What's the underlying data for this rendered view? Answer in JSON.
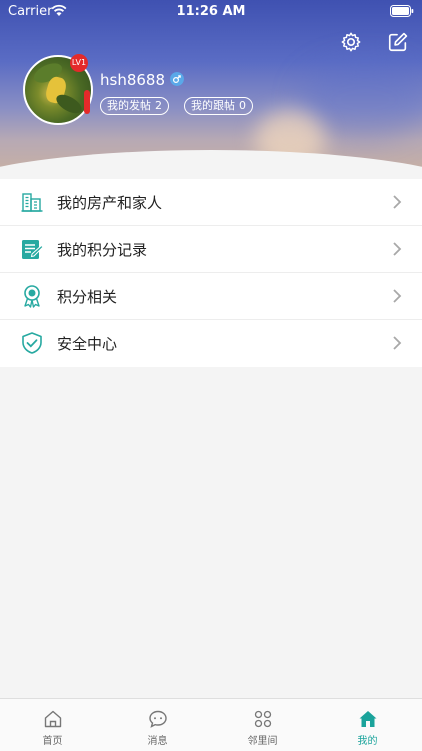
{
  "status_bar": {
    "carrier": "Carrier",
    "time": "11:26 AM"
  },
  "header": {
    "settings_icon": "gear-icon",
    "edit_icon": "edit-icon",
    "level_badge": "LV1",
    "username": "hsh8688",
    "gender_icon": "male-icon",
    "posts_label": "我的发帖",
    "posts_count": "2",
    "replies_label": "我的跟帖",
    "replies_count": "0"
  },
  "menu": {
    "items": [
      {
        "label": "我的房产和家人",
        "icon": "building-icon"
      },
      {
        "label": "我的积分记录",
        "icon": "points-record-icon"
      },
      {
        "label": "积分相关",
        "icon": "medal-icon"
      },
      {
        "label": "安全中心",
        "icon": "shield-check-icon"
      }
    ]
  },
  "tabbar": {
    "tabs": [
      {
        "label": "首页",
        "icon": "home-outline-icon"
      },
      {
        "label": "消息",
        "icon": "chat-icon"
      },
      {
        "label": "邻里间",
        "icon": "grid-icon"
      },
      {
        "label": "我的",
        "icon": "home-filled-icon",
        "active": true
      }
    ]
  },
  "colors": {
    "accent": "#1aa39b",
    "badge_red": "#e42a2a",
    "header_blue": "#3f51b1"
  }
}
